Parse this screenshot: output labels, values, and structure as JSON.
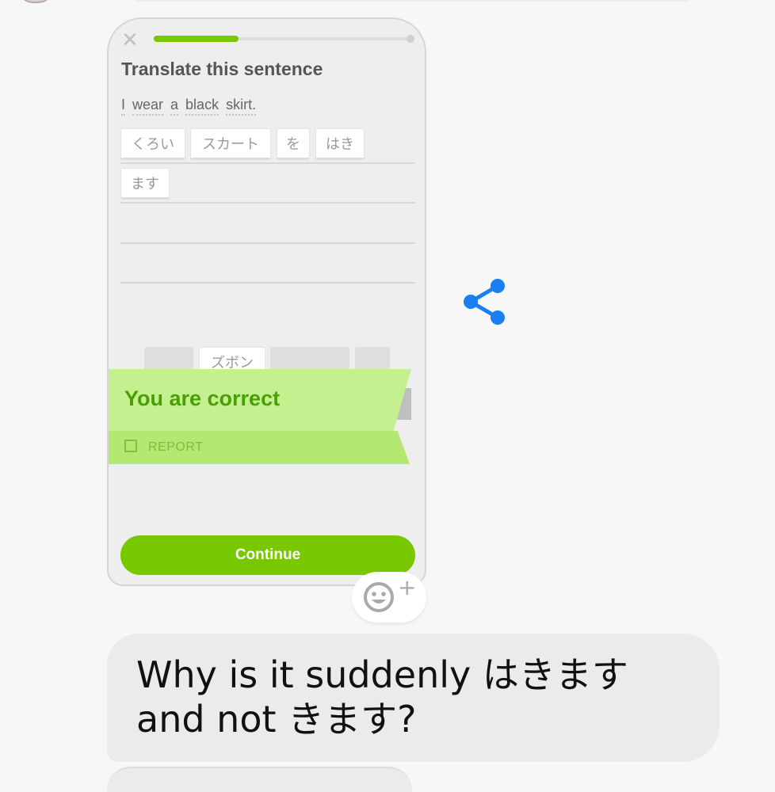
{
  "lesson": {
    "progress": 0.33,
    "title": "Translate this sentence",
    "sentence_words": [
      "I",
      "wear",
      "a",
      "black",
      "skirt."
    ],
    "answer_chips": [
      "くろい",
      "スカート",
      "を",
      "はき",
      "ます"
    ],
    "bank_visible_chip": "ズボン",
    "result_message": "You are correct",
    "report_label": "REPORT",
    "continue_label": "Continue"
  },
  "message": {
    "text": "Why is it suddenly はきます and not きます?"
  },
  "colors": {
    "accent_green": "#78c800",
    "correct_banner": "#c5f08f",
    "share_icon": "#1a7ff0"
  },
  "icons": {
    "close": "close-icon",
    "share": "share-icon",
    "reaction": "smiley-plus-icon",
    "report": "flag-icon"
  }
}
